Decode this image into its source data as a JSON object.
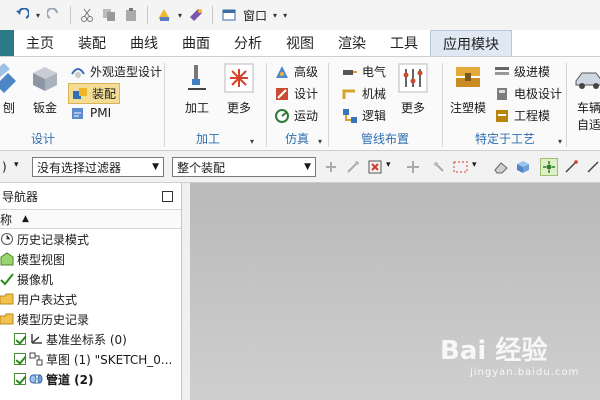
{
  "quick_access": {
    "window_label": "窗口"
  },
  "tabs": [
    "主页",
    "装配",
    "曲线",
    "曲面",
    "分析",
    "视图",
    "渲染",
    "工具",
    "应用模块"
  ],
  "active_tab": "应用模块",
  "ribbon": {
    "design_group": {
      "label": "设计",
      "partial_label": "刨",
      "sheetmetal": "钣金",
      "appearance": "外观造型设计",
      "assembly": "装配",
      "pmi": "PMI"
    },
    "machining_group": {
      "label": "加工",
      "machining": "加工",
      "more": "更多"
    },
    "simulation_group": {
      "label": "仿真",
      "advanced": "高级",
      "design": "设计",
      "motion": "运动"
    },
    "routing_group": {
      "label": "管线布置",
      "electrical": "电气",
      "mechanical": "机械",
      "logic": "逻辑",
      "more": "更多"
    },
    "process_group": {
      "label": "特定于工艺",
      "injection_mold": "注塑模",
      "progressive_die": "级进模",
      "electrode": "电极设计",
      "engineering_die": "工程模"
    },
    "vehicle_group": {
      "partial_label_1": "车辆",
      "partial_label_2": "自适"
    }
  },
  "filter_bar": {
    "left_value": ")",
    "selection_filter": "没有选择过滤器",
    "scope": "整个装配"
  },
  "navigator": {
    "title": "导航器",
    "column_header": "称",
    "items": [
      {
        "label": "历史记录模式"
      },
      {
        "label": "模型视图"
      },
      {
        "label": "摄像机"
      },
      {
        "label": "用户表达式"
      },
      {
        "label": "模型历史记录"
      },
      {
        "label": "基准坐标系 (0)"
      },
      {
        "label": "草图 (1) \"SKETCH_0..."
      },
      {
        "label": "管道 (2)"
      }
    ]
  },
  "watermark": {
    "text": "Bai 经验",
    "url": "jingyan.baidu.com"
  },
  "colors": {
    "accent": "#2f6fb1",
    "tab_lead": "#2c7b86",
    "selected_bg": "#f3dd95",
    "canvas": "#c4c4c4"
  }
}
